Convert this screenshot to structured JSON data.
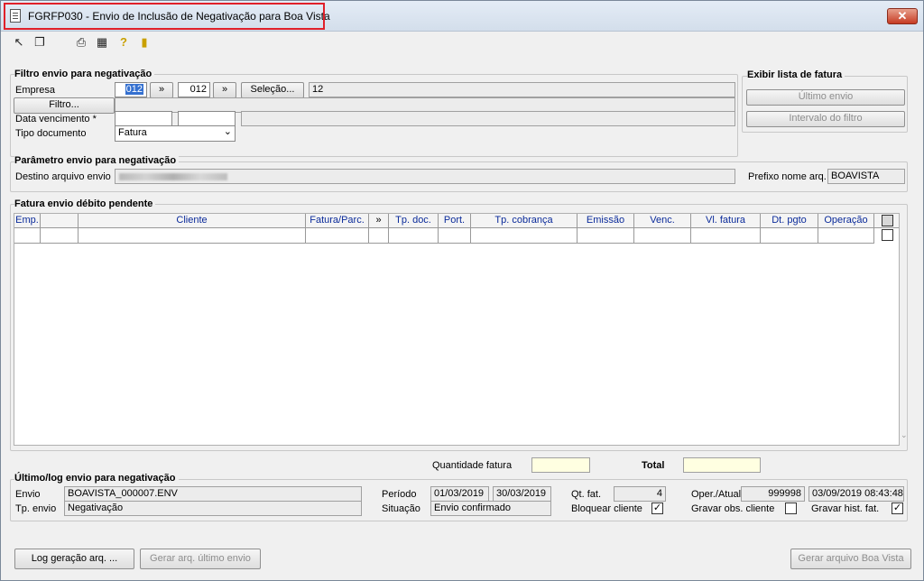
{
  "window": {
    "title": "FGRFP030 - Envio de Inclusão de Negativação para Boa Vista",
    "close_label": "✕"
  },
  "toolbar": {
    "icons": [
      "cursor-icon",
      "copy-icon",
      "print-icon",
      "calculator-icon",
      "help-icon",
      "exit-door-icon"
    ]
  },
  "filtro": {
    "title": "Filtro envio para negativação",
    "empresa_label": "Empresa",
    "empresa_from": "012",
    "empresa_to": "012",
    "arrow_label": "»",
    "selecao_label": "Seleção...",
    "empresa_desc": "12",
    "filtro_label": "Filtro...",
    "data_venc_label": "Data vencimento *",
    "tipo_doc_label": "Tipo documento",
    "tipo_doc_value": "Fatura"
  },
  "exibir": {
    "title": "Exibir lista de fatura",
    "ultimo_envio": "Último envio",
    "intervalo": "Intervalo do filtro"
  },
  "parametro": {
    "title": "Parâmetro envio para negativação",
    "destino_label": "Destino arquivo envio",
    "prefixo_label": "Prefixo nome arq.",
    "prefixo_value": "BOAVISTA"
  },
  "fatura": {
    "title": "Fatura envio débito pendente",
    "columns": [
      "Emp.",
      "Cliente",
      "Fatura/Parc.",
      "»",
      "Tp. doc.",
      "Port.",
      "Tp. cobrança",
      "Emissão",
      "Venc.",
      "Vl. fatura",
      "Dt. pgto",
      "Operação"
    ]
  },
  "totals": {
    "quantidade_label": "Quantidade fatura",
    "total_label": "Total"
  },
  "log": {
    "title": "Último/log envio para negativação",
    "envio_label": "Envio",
    "envio_value": "BOAVISTA_000007.ENV",
    "tp_envio_label": "Tp. envio",
    "tp_envio_value": "Negativação",
    "periodo_label": "Período",
    "periodo_from": "01/03/2019",
    "periodo_to": "30/03/2019",
    "situacao_label": "Situação",
    "situacao_value": "Envio confirmado",
    "qt_fat_label": "Qt. fat.",
    "qt_fat_value": "4",
    "bloquear_label": "Bloquear cliente",
    "bloquear_checked": true,
    "oper_label": "Oper./Atual.",
    "oper_value": "999998",
    "oper_datetime": "03/09/2019 08:43:48",
    "gravar_obs_label": "Gravar obs. cliente",
    "gravar_obs_checked": false,
    "gravar_hist_label": "Gravar hist. fat.",
    "gravar_hist_checked": true
  },
  "footer": {
    "log_btn": "Log geração arq. ...",
    "gerar_ultimo_btn": "Gerar arq. último envio",
    "gerar_boa_vista_btn": "Gerar arquivo Boa Vista"
  }
}
